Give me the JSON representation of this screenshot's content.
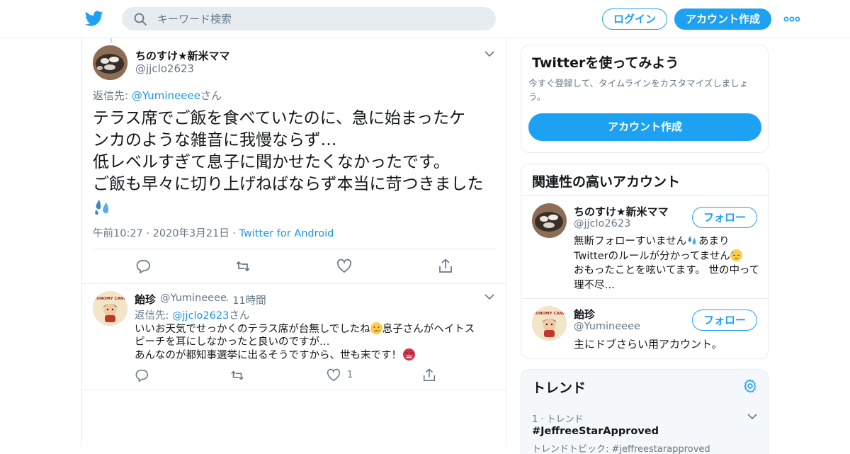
{
  "header": {
    "search_placeholder": "キーワード検索",
    "login_label": "ログイン",
    "signup_label": "アカウント作成"
  },
  "main_tweet": {
    "name": "ちのすけ★新米ママ",
    "handle": "@jjclo2623",
    "reply_prefix": "返信先: ",
    "reply_to": "@Yumineeee",
    "reply_suffix": "さん",
    "text_lines": [
      "テラス席でご飯を食べていたのに、急に始まったケ",
      "ンカのような雑音に我慢ならず…",
      "低レベルすぎて息子に聞かせたくなかったです。",
      "ご飯も早々に切り上げねばならず本当に苛つきました"
    ],
    "timestamp": "午前10:27 · 2020年3月21日 · ",
    "source": "Twitter for Android"
  },
  "reply_tweet": {
    "name": "飴珍",
    "handle": "@Yumineeee",
    "time": "· 11時間",
    "reply_prefix": "返信先: ",
    "reply_to": "@jjclo2623",
    "reply_suffix": "さん",
    "text_1": "いいお天気でせっかくのテラス席が台無しでしたね",
    "text_2": "息子さんがヘイトス",
    "text_3": "ピーチを耳にしなかったと良いのですが…",
    "text_4": "あんなのが都知事選挙に出るそうですから、世も末です！",
    "like_count": "1",
    "avatar_text": "ECONOMY CANDY"
  },
  "signup_card": {
    "title": "Twitterを使ってみよう",
    "subtitle": "今すぐ登録して、タイムラインをカスタマイズしましょう。",
    "button": "アカウント作成"
  },
  "related": {
    "title": "関連性の高いアカウント",
    "follow_label": "フォロー",
    "accounts": [
      {
        "name": "ちのすけ★新米ママ",
        "handle": "@jjclo2623",
        "bio_1": "無断フォローすいません",
        "bio_2": "あまり",
        "bio_3": "Twitterのルールが分かってません",
        "bio_4": "おもったことを呟いてます。 世の中って理不尽…"
      },
      {
        "name": "飴珍",
        "handle": "@Yumineeee",
        "bio": "主にドブさらい用アカウント。"
      }
    ]
  },
  "trends": {
    "title": "トレンド",
    "items": [
      {
        "rank": "1 · トレンド",
        "name": "#JeffreeStarApproved",
        "topic": "トレンドトピック: #jeffreestarapproved"
      }
    ]
  },
  "colors": {
    "brand": "#1da1f2",
    "link": "#1b95e0",
    "muted": "#657786",
    "border": "#e6ecf0"
  }
}
